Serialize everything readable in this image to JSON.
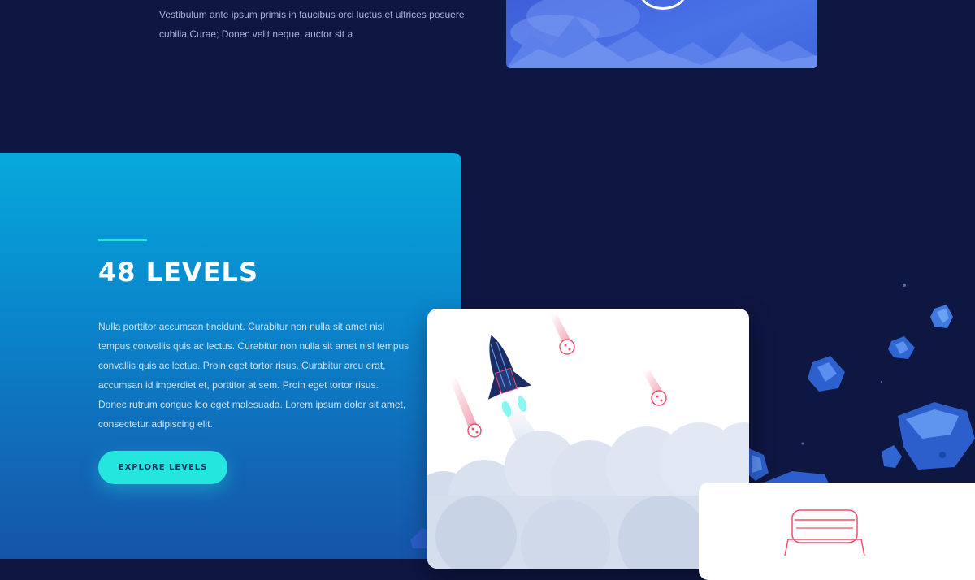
{
  "intro": {
    "lines": [
      "Vestibulum ante ipsum primis in faucibus orci luctus et ultrices posuere",
      "cubilia Curae; Donec velit neque, auctor sit a"
    ]
  },
  "features": {
    "levels": {
      "title": "48 LEVELS",
      "body_lines": [
        "Nulla porttitor accumsan tincidunt. Curabitur non nulla sit amet nisl",
        "tempus convallis quis ac lectus. Curabitur non nulla sit amet nisl tempus",
        "convallis quis ac lectus. Proin eget tortor risus. Curabitur arcu erat,",
        "accumsan id imperdiet et, porttitor at sem. Proin eget tortor risus.",
        "Donec rutrum congue leo eget malesuada. Lorem ipsum dolor sit amet,",
        "consectetur adipiscing elit."
      ],
      "cta_label": "EXPLORE LEVELS"
    }
  },
  "colors": {
    "page_bg": "#0e1642",
    "accent": "#25e6df",
    "card_gradient_top": "#07a9dc",
    "card_gradient_bottom": "#1654a8",
    "meteor": "#f0506e"
  },
  "icons": [
    "play-icon",
    "rocket-icon",
    "meteor-icon",
    "asteroid-icon",
    "cloud-icon",
    "capsule-icon"
  ]
}
